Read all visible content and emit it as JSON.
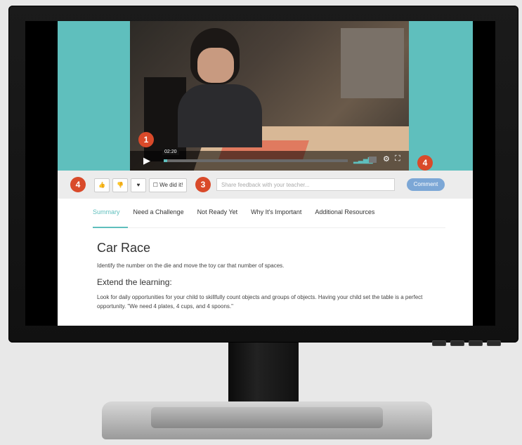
{
  "video": {
    "timestamp": "02:20",
    "progress": 0.02
  },
  "annotations": {
    "badge_video": "1",
    "badge_reactions": "4",
    "badge_feedback": "3",
    "badge_comment": "4"
  },
  "action_bar": {
    "thumbs_up_glyph": "👍",
    "thumbs_down_glyph": "👎",
    "heart_glyph": "♥",
    "we_did_it_label": "☐ We did it!",
    "feedback_placeholder": "Share feedback with your teacher...",
    "comment_label": "Comment"
  },
  "tabs": [
    {
      "label": "Summary"
    },
    {
      "label": "Need a Challenge"
    },
    {
      "label": "Not Ready Yet"
    },
    {
      "label": "Why It's Important"
    },
    {
      "label": "Additional Resources"
    }
  ],
  "activity": {
    "title": "Car Race",
    "description": "Identify the number on the die and move the toy car that number of spaces.",
    "extend_heading": "Extend the learning:",
    "extend_text": "Look for daily opportunities for your child to skillfully count objects and groups of objects. Having your child set the table is a perfect opportunity. \"We need 4 plates, 4 cups, and 4 spoons.\""
  },
  "colors": {
    "teal": "#5fbfbd",
    "badge_red": "#d94a2a",
    "comment_blue": "#7ca7d6"
  }
}
